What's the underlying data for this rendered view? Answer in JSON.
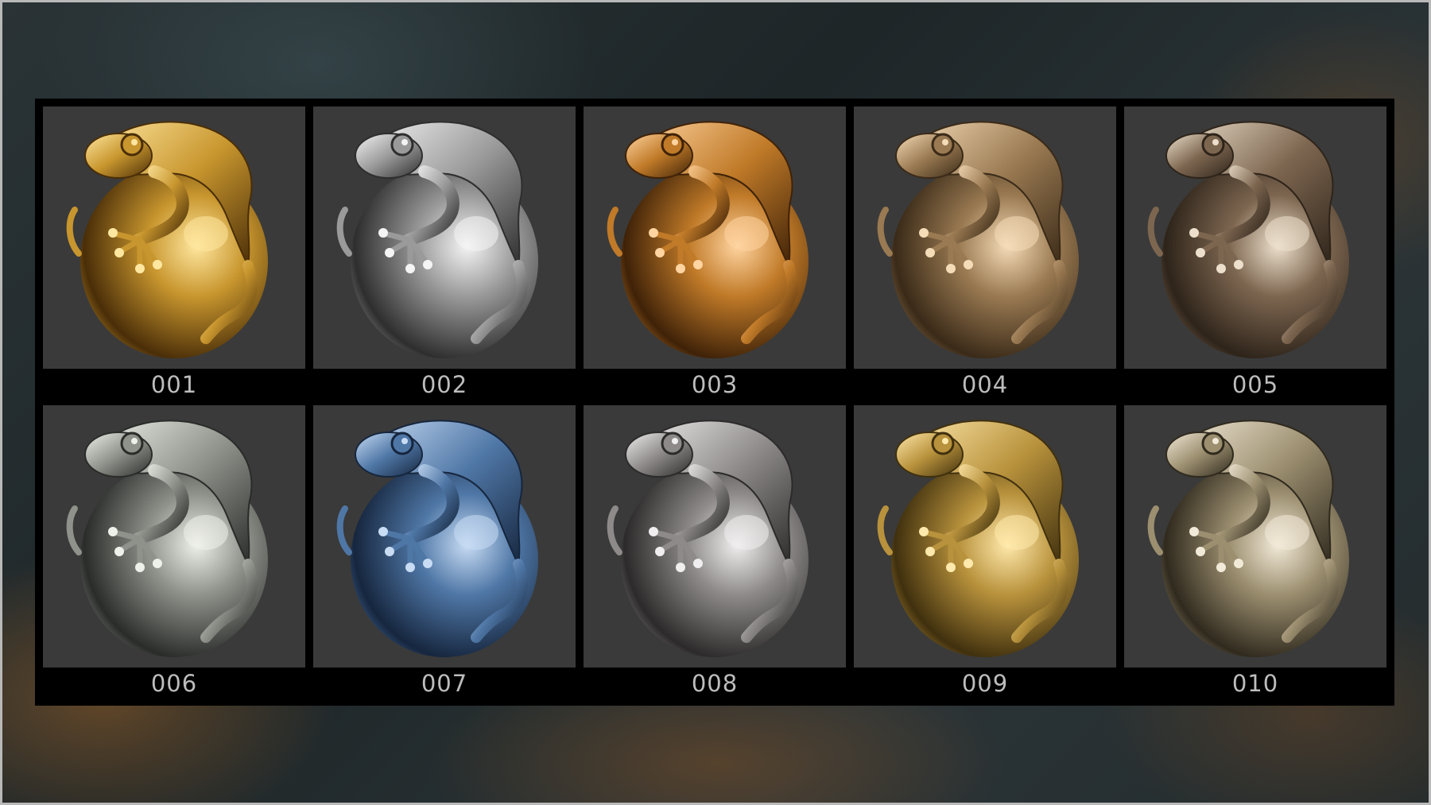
{
  "materials": [
    {
      "label": "001",
      "hi": "#ffe7a0",
      "mid": "#c8962e",
      "dark": "#4a2e08"
    },
    {
      "label": "002",
      "hi": "#f4f4f4",
      "mid": "#9a9a9a",
      "dark": "#2e2e2e"
    },
    {
      "label": "003",
      "hi": "#ffd4a0",
      "mid": "#c07a28",
      "dark": "#3f2208"
    },
    {
      "label": "004",
      "hi": "#f5dcb8",
      "mid": "#9a7a52",
      "dark": "#3a2a18"
    },
    {
      "label": "005",
      "hi": "#ece0cc",
      "mid": "#7d6650",
      "dark": "#2e241a"
    },
    {
      "label": "006",
      "hi": "#eef0ea",
      "mid": "#8e928a",
      "dark": "#2a2c2a"
    },
    {
      "label": "007",
      "hi": "#c8dcf4",
      "mid": "#4f77a6",
      "dark": "#16263e"
    },
    {
      "label": "008",
      "hi": "#f0eeee",
      "mid": "#8e8a8a",
      "dark": "#2c2a2a"
    },
    {
      "label": "009",
      "hi": "#ffe9ac",
      "mid": "#b8923c",
      "dark": "#40300e"
    },
    {
      "label": "010",
      "hi": "#f2ead8",
      "mid": "#9c8f70",
      "dark": "#302a1e"
    }
  ]
}
